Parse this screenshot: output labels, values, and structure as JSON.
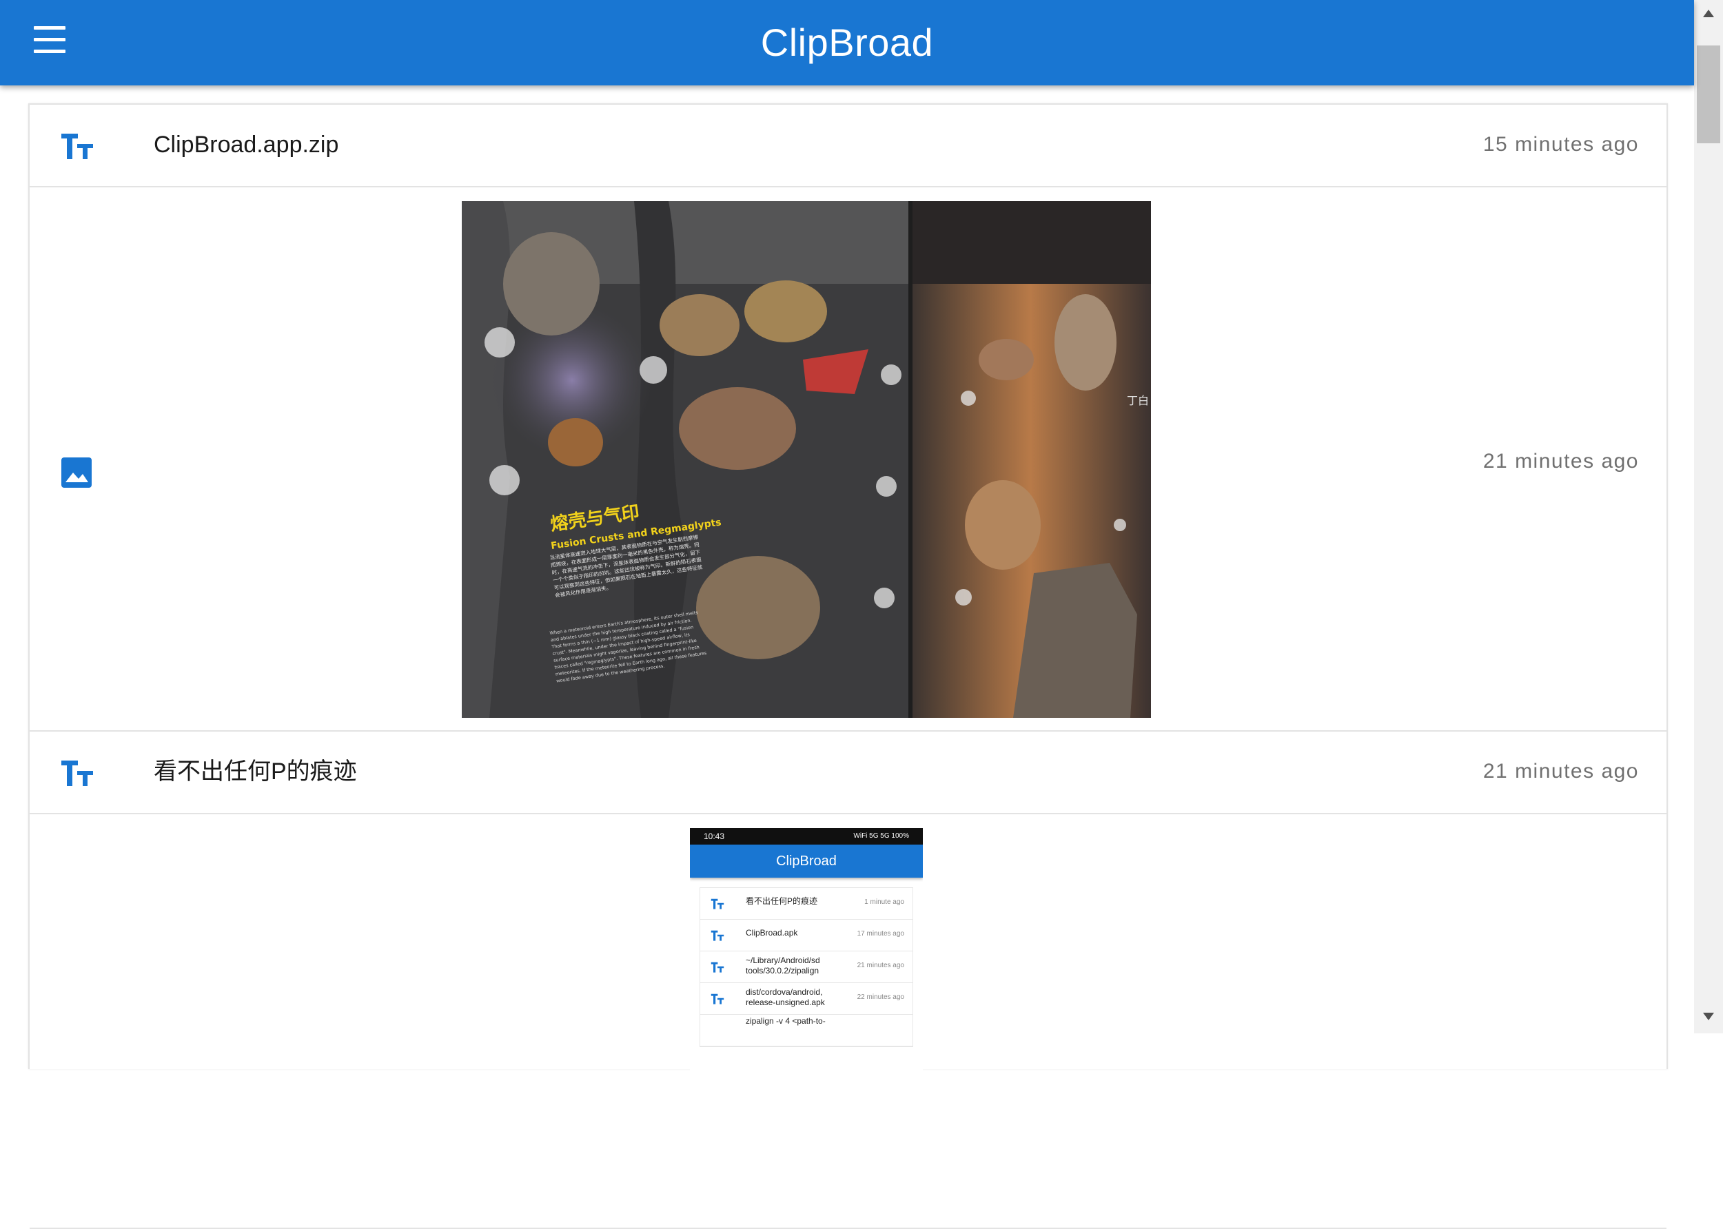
{
  "app": {
    "title": "ClipBroad"
  },
  "accent": "#1976d2",
  "icons": {
    "menu": "menu-icon",
    "text": "text-fields-icon",
    "image": "image-icon"
  },
  "items": [
    {
      "type": "text",
      "content": "ClipBroad.app.zip",
      "time": "15 minutes ago"
    },
    {
      "type": "image",
      "time": "21 minutes ago",
      "photo": {
        "title_zh": "熔壳与气印",
        "title_en": "Fusion Crusts and Regmaglypts",
        "body_zh": "当流星体高速进入地球大气层，其表面物质在与空气发生剧烈摩擦而燃烧，在表面形成一层厚度约一毫米的黑色外壳，称为熔壳。同时，在高速气流的冲击下，流星体表面物质会发生部分气化，留下一个个类似于指印的凹坑。这些凹坑被称为气印。新鲜的陨石表面可以观察到这些特征，但如果陨石在地面上暴露太久，这些特征就会被风化作用逐渐消失。",
        "body_en": "When a meteoroid enters Earth's atmosphere, its outer shell melts and ablates under the high temperature induced by air friction. That forms a thin (~1 mm) glassy black coating called a \"fusion crust\". Meanwhile, under the impact of high-speed airflow, its surface materials might vaporize, leaving behind fingerprint-like traces called \"regmaglypts\". These features are common in fresh meteorites. If the meteorite fell to Earth long ago, all these features would fade away due to the weathering process.",
        "side_text": "丁白"
      }
    },
    {
      "type": "text",
      "content": "看不出任何P的痕迹",
      "time": "21 minutes ago"
    },
    {
      "type": "image",
      "phone": {
        "status_time": "10:43",
        "status_right": "WiFi 5G 5G 100%",
        "title": "ClipBroad",
        "rows": [
          {
            "text": "看不出任何P的痕迹",
            "time": "1 minute ago"
          },
          {
            "text": "ClipBroad.apk",
            "time": "17 minutes ago"
          },
          {
            "text": "~/Library/Android/sdk/build-tools/30.0.2/zipalign",
            "text_l1": "~/Library/Android/sd",
            "text_l2": "tools/30.0.2/zipalign",
            "time": "21 minutes ago"
          },
          {
            "text": "dist/cordova/android/release-unsigned.apk",
            "text_l1": "dist/cordova/android,",
            "text_l2": "release-unsigned.apk",
            "time": "22 minutes ago"
          },
          {
            "text": "zipalign -v 4 <path-to-",
            "time": ""
          }
        ]
      }
    }
  ]
}
